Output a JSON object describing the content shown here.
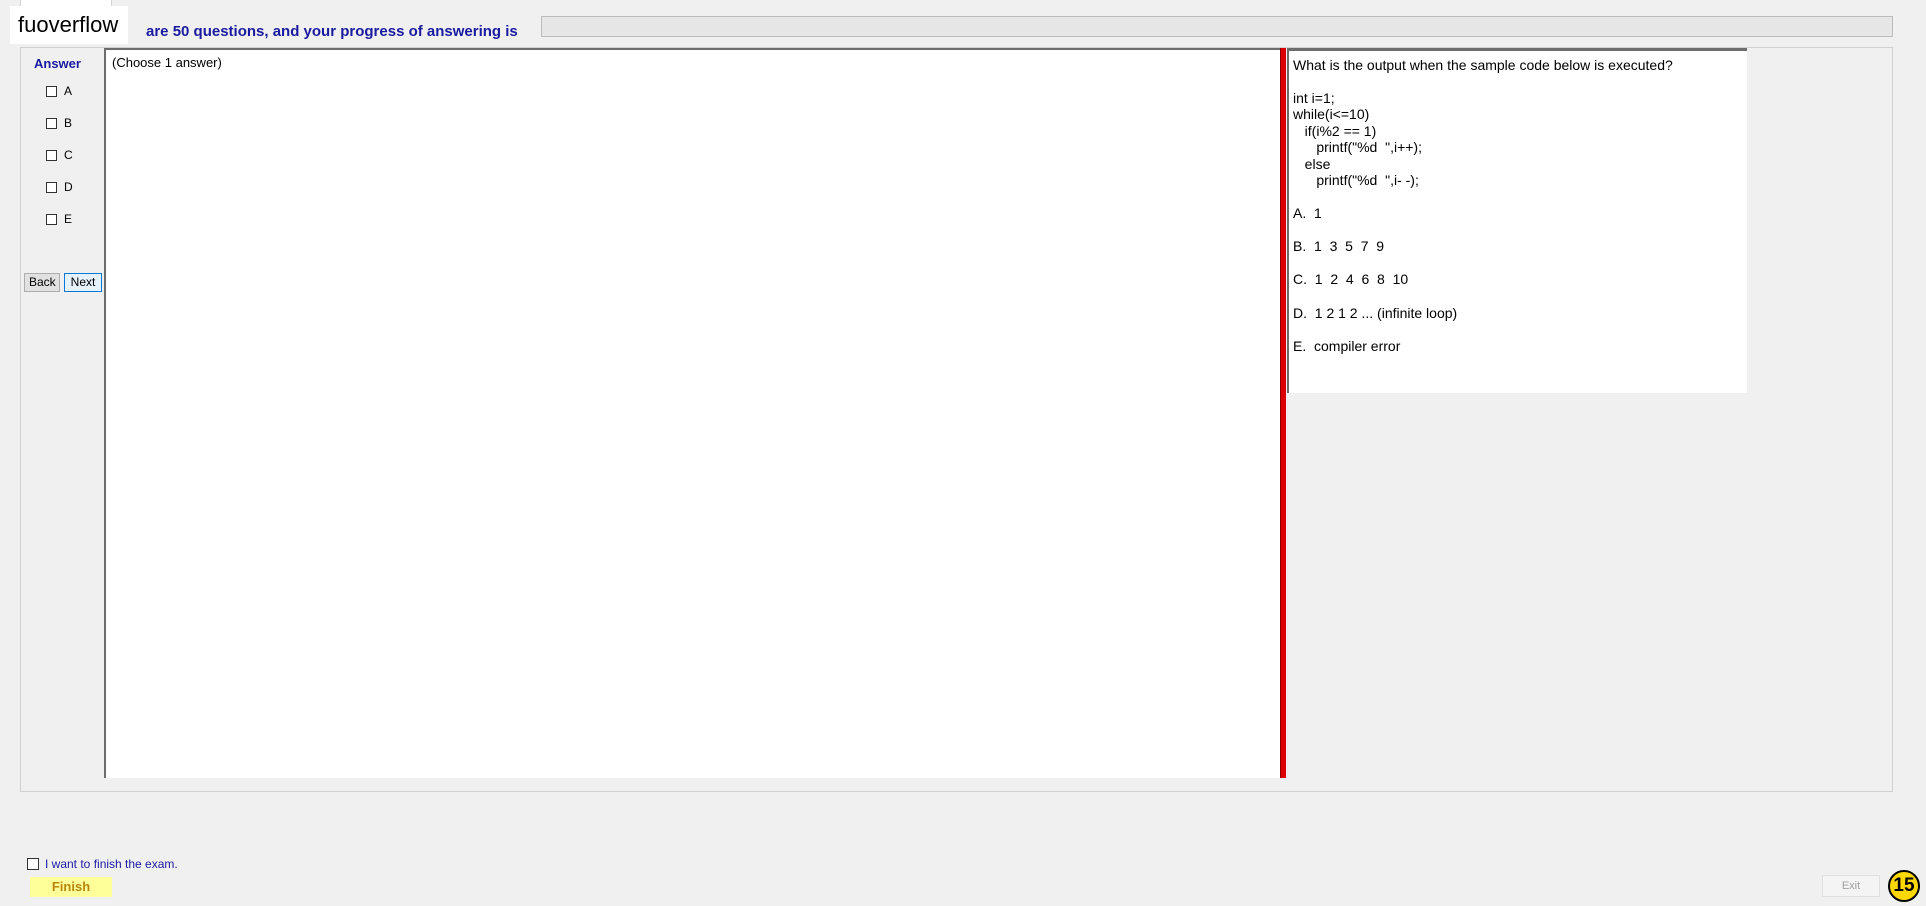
{
  "header": {
    "logo_text": "fuoverflow",
    "progress_text": "are 50 questions, and your progress of answering is",
    "progress_value": 0
  },
  "answer_panel": {
    "title": "Answer",
    "options": [
      "A",
      "B",
      "C",
      "D",
      "E"
    ],
    "back_label": "Back",
    "next_label": "Next"
  },
  "answer_area": {
    "hint": "(Choose 1 answer)"
  },
  "question": {
    "lines": [
      "What is the output when the sample code below is executed?",
      "",
      "int i=1;",
      "while(i<=10)",
      "   if(i%2 == 1)",
      "      printf(\"%d  \",i++);",
      "   else",
      "      printf(\"%d  \",i- -);",
      "",
      "A.  1",
      "",
      "B.  1  3  5  7  9",
      "",
      "C.  1  2  4  6  8  10",
      "",
      "D.  1 2 1 2 ... (infinite loop)",
      "",
      "E.  compiler error"
    ]
  },
  "footer": {
    "finish_check_label": "I want to finish the exam.",
    "finish_label": "Finish",
    "exit_label": "Exit",
    "badge_number": "15"
  },
  "colors": {
    "accent_text": "#1a1aa0",
    "splitter": "#dd0000",
    "finish_bg": "#ffff99",
    "badge_bg": "#ffd800"
  }
}
